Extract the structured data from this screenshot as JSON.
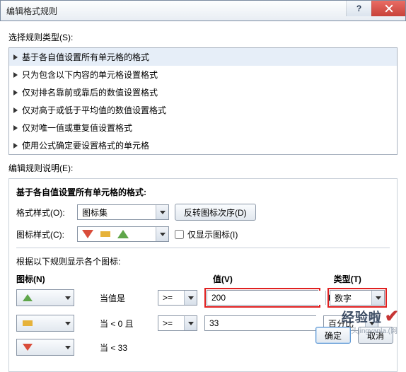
{
  "window": {
    "title": "编辑格式规则"
  },
  "ruleType": {
    "label": "选择规则类型(S):",
    "items": [
      "基于各自值设置所有单元格的格式",
      "只为包含以下内容的单元格设置格式",
      "仅对排名靠前或靠后的数值设置格式",
      "仅对高于或低于平均值的数值设置格式",
      "仅对唯一值或重复值设置格式",
      "使用公式确定要设置格式的单元格"
    ]
  },
  "ruleDesc": {
    "label": "编辑规则说明(E):"
  },
  "formatGroup": {
    "title": "基于各自值设置所有单元格的格式:",
    "styleLabel": "格式样式(O):",
    "styleValue": "图标集",
    "reverseBtn": "反转图标次序(D)",
    "iconStyleLabel": "图标样式(C):",
    "showOnlyLabel": "仅显示图标(I)"
  },
  "iconRules": {
    "heading": "根据以下规则显示各个图标:",
    "headers": {
      "icon": "图标(N)",
      "value": "值(V)",
      "type": "类型(T)"
    },
    "rows": [
      {
        "when": "当值是",
        "op": ">=",
        "value": "200",
        "type": "数字"
      },
      {
        "when": "当 < 0 且",
        "op": ">=",
        "value": "33",
        "type": "百分比"
      },
      {
        "when": "当 < 33",
        "op": "",
        "value": "",
        "type": ""
      }
    ]
  },
  "buttons": {
    "ok": "确定",
    "cancel": "取消"
  },
  "watermark": {
    "text1": "经验啦",
    "sub": "头jingyanla.(网"
  }
}
